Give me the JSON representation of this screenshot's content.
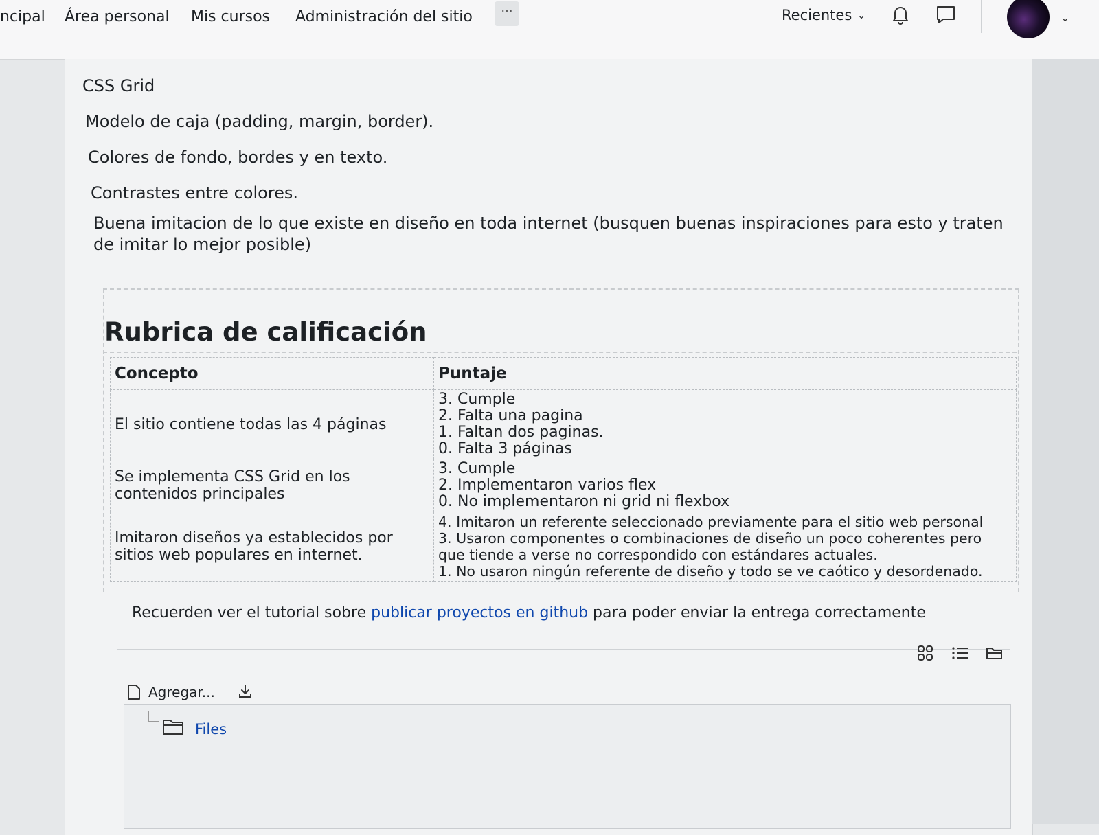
{
  "navbar": {
    "links": [
      "ncipal",
      "Área personal",
      "Mis cursos",
      "Administración del sitio"
    ],
    "more_label": "···",
    "recent_label": "Recientes",
    "icons": [
      "bell-icon",
      "chat-icon",
      "chevron-down-icon"
    ]
  },
  "content": {
    "requirements": [
      "CSS Grid",
      "Modelo de caja (padding, margin, border).",
      "Colores de fondo, bordes y en texto.",
      "Contrastes entre colores.",
      "Buena imitacion de lo que existe en diseño en toda internet (busquen buenas inspiraciones para esto y traten de imitar lo mejor posible)"
    ],
    "rubric": {
      "title": "Rubrica de calificación",
      "headers": [
        "Concepto",
        "Puntaje"
      ],
      "rows": [
        {
          "concept": "El sitio contiene todas las 4 páginas",
          "scores": [
            "3. Cumple",
            "2. Falta una pagina",
            "1. Faltan dos paginas.",
            "0. Falta 3 páginas"
          ]
        },
        {
          "concept": "Se implementa CSS Grid en los contenidos principales",
          "scores": [
            "3. Cumple",
            "2. Implementaron varios flex",
            "0. No implementaron ni grid ni flexbox"
          ]
        },
        {
          "concept": "Imitaron diseños ya establecidos por sitios web populares en internet.",
          "scores": [
            "4. Imitaron un referente seleccionado previamente para el sitio web personal",
            "3. Usaron componentes o combinaciones de diseño un poco coherentes pero que tiende a verse no correspondido con estándares actuales.",
            "1. No usaron ningún referente de diseño y todo se ve caótico y desordenado."
          ]
        }
      ]
    },
    "note": {
      "before": "Recuerden ver el tutorial sobre ",
      "link": "publicar proyectos en github",
      "after": " para poder enviar la entrega correctamente"
    }
  },
  "file_manager": {
    "add_label": "Agregar...",
    "folder_label": "Files",
    "view_icons": [
      "grid-view-icon",
      "list-view-icon",
      "folder-view-icon"
    ]
  }
}
